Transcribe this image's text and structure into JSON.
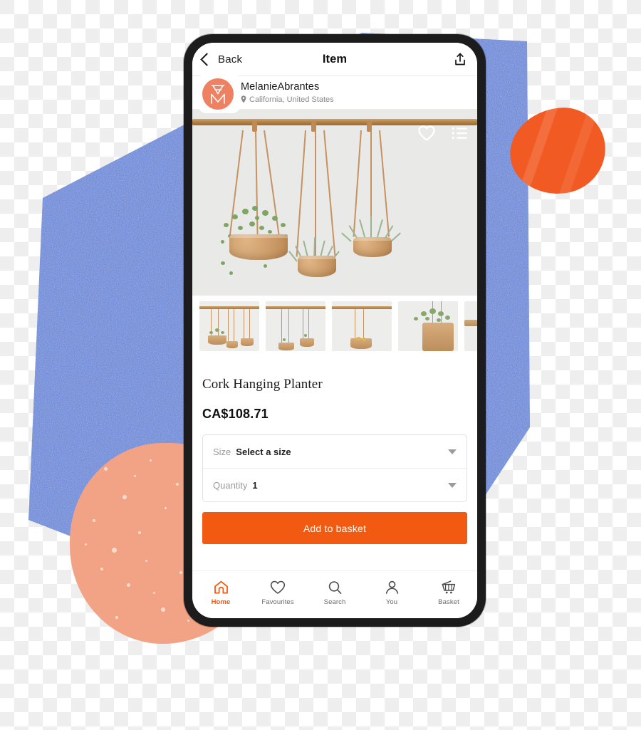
{
  "theme": {
    "brand_orange": "#f15a10",
    "avatar_coral": "#ef8163",
    "blue_shape": "#5a7fd6",
    "peach_shape": "#f3a385",
    "orange_blob": "#f15a22",
    "phone_bezel": "#1c1c1c"
  },
  "header": {
    "back_label": "Back",
    "title": "Item",
    "back_icon": "chevron-left-icon",
    "share_icon": "share-icon"
  },
  "seller": {
    "name": "MelanieAbrantes",
    "location": "California, United States",
    "location_icon": "map-pin-icon",
    "avatar_monogram": "AM"
  },
  "hero": {
    "favourite_icon": "heart-outline-icon",
    "list_icon": "list-icon",
    "alt": "Three cork hanging planters suspended from a wooden rod"
  },
  "thumbnails": [
    {
      "alt": "Three cork hanging planters on rod"
    },
    {
      "alt": "Two cork hanging planters with grass"
    },
    {
      "alt": "Single cork hanging planter with fruit"
    },
    {
      "alt": "Close-up cork planter with trailing plant"
    },
    {
      "alt": "Wooden rod detail"
    }
  ],
  "product": {
    "title": "Cork Hanging Planter",
    "price": "CA$108.71"
  },
  "options": [
    {
      "label": "Size",
      "value": "Select a size",
      "caret_icon": "caret-down-icon"
    },
    {
      "label": "Quantity",
      "value": "1",
      "caret_icon": "caret-down-icon"
    }
  ],
  "cta": {
    "label": "Add to basket"
  },
  "bottom_nav": {
    "items": [
      {
        "label": "Home",
        "icon": "home-icon",
        "active": true
      },
      {
        "label": "Favourites",
        "icon": "heart-icon",
        "active": false
      },
      {
        "label": "Search",
        "icon": "search-icon",
        "active": false
      },
      {
        "label": "You",
        "icon": "person-icon",
        "active": false
      },
      {
        "label": "Basket",
        "icon": "basket-icon",
        "active": false
      }
    ]
  }
}
